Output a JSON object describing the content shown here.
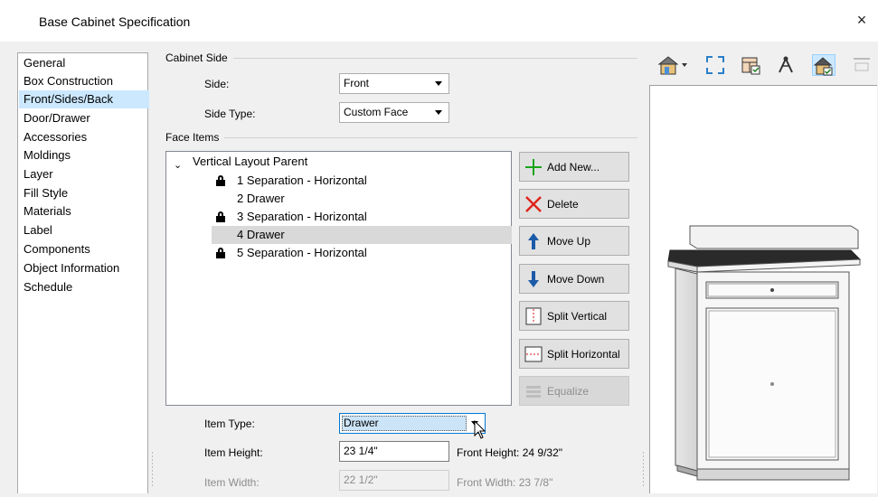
{
  "window": {
    "title": "Base Cabinet Specification",
    "close_glyph": "×"
  },
  "sidebar": {
    "items": [
      {
        "label": "General"
      },
      {
        "label": "Box Construction"
      },
      {
        "label": "Front/Sides/Back",
        "selected": true
      },
      {
        "label": "Door/Drawer"
      },
      {
        "label": "Accessories"
      },
      {
        "label": "Moldings"
      },
      {
        "label": "Layer"
      },
      {
        "label": "Fill Style"
      },
      {
        "label": "Materials"
      },
      {
        "label": "Label"
      },
      {
        "label": "Components"
      },
      {
        "label": "Object Information"
      },
      {
        "label": "Schedule"
      }
    ]
  },
  "cabinet_side": {
    "group_label": "Cabinet Side",
    "side_label": "Side:",
    "side_value": "Front",
    "side_type_label": "Side Type:",
    "side_type_value": "Custom Face"
  },
  "face_items": {
    "group_label": "Face Items",
    "tree": {
      "root": "Vertical Layout Parent",
      "children": [
        {
          "label": "1 Separation - Horizontal",
          "locked": true
        },
        {
          "label": "2 Drawer",
          "locked": false
        },
        {
          "label": "3 Separation - Horizontal",
          "locked": true
        },
        {
          "label": "4 Drawer",
          "locked": false,
          "selected": true
        },
        {
          "label": "5 Separation - Horizontal",
          "locked": true
        }
      ]
    },
    "buttons": {
      "add_new": "Add New...",
      "delete": "Delete",
      "move_up": "Move Up",
      "move_down": "Move Down",
      "split_vertical": "Split Vertical",
      "split_horizontal": "Split Horizontal",
      "equalize": "Equalize"
    }
  },
  "item": {
    "type_label": "Item Type:",
    "type_value": "Drawer",
    "height_label": "Item Height:",
    "height_value": "23 1/4\"",
    "front_height_label": "Front Height:",
    "front_height_value": "24 9/32\"",
    "width_label": "Item Width:",
    "width_value": "22 1/2\"",
    "front_width_label": "Front Width:",
    "front_width_value": "23 7/8\""
  },
  "preview_toolbar": {
    "icons": [
      "house-view-dropdown-icon",
      "fill-window-icon",
      "cabinet-view-icon",
      "orbit-icon",
      "house-check-icon",
      "extra-tool-icon"
    ]
  },
  "colors": {
    "selection": "#cce8ff",
    "tree_selection": "#d9d9d9",
    "add_green": "#19a519",
    "delete_red": "#e0241b",
    "arrow_blue": "#1c5aa8"
  }
}
